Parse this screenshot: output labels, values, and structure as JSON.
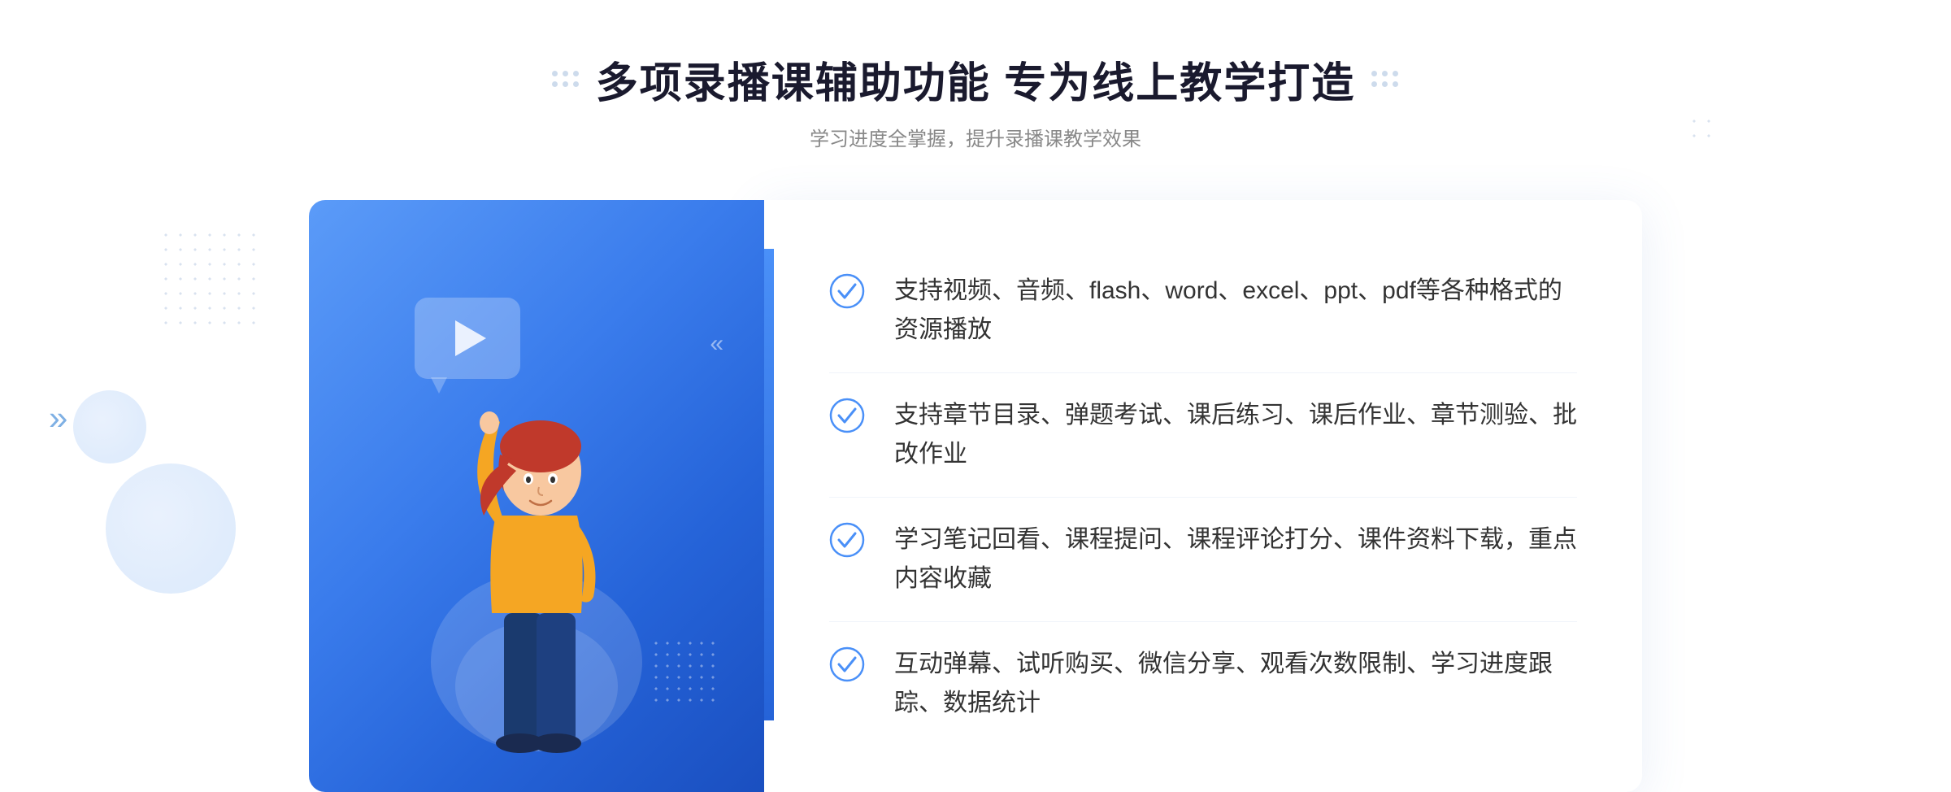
{
  "page": {
    "background": "#ffffff"
  },
  "header": {
    "title": "多项录播课辅助功能 专为线上教学打造",
    "subtitle": "学习进度全掌握，提升录播课教学效果",
    "deco_left_dots": "decorative",
    "deco_right_dots": "decorative"
  },
  "features": [
    {
      "id": 1,
      "text": "支持视频、音频、flash、word、excel、ppt、pdf等各种格式的资源播放"
    },
    {
      "id": 2,
      "text": "支持章节目录、弹题考试、课后练习、课后作业、章节测验、批改作业"
    },
    {
      "id": 3,
      "text": "学习笔记回看、课程提问、课程评论打分、课件资料下载，重点内容收藏"
    },
    {
      "id": 4,
      "text": "互动弹幕、试听购买、微信分享、观看次数限制、学习进度跟踪、数据统计"
    }
  ],
  "illustration": {
    "play_button": "▶",
    "arrow_decoration": "«",
    "left_arrow": "»"
  }
}
